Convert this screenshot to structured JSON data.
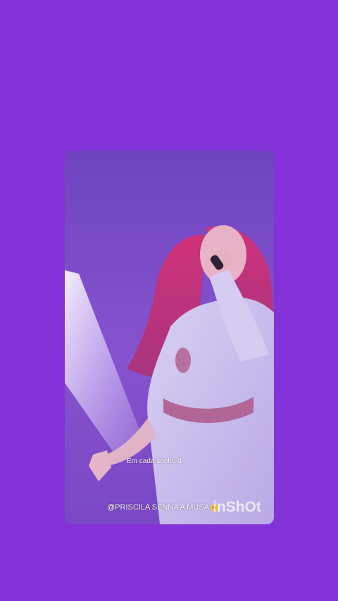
{
  "background_color": "#8433d8",
  "video": {
    "subtitle_text": "Em cada sonho d",
    "caption_text": "@PRISCILA SENNA A MUSA",
    "caption_emoji": "face-emoji-icon",
    "watermark_text": "inShOt"
  },
  "colors": {
    "card_tint": "#8a55d4",
    "hair": "#c2367a",
    "dress": "#cfc4ec",
    "light_beam": "#f2eaff"
  }
}
